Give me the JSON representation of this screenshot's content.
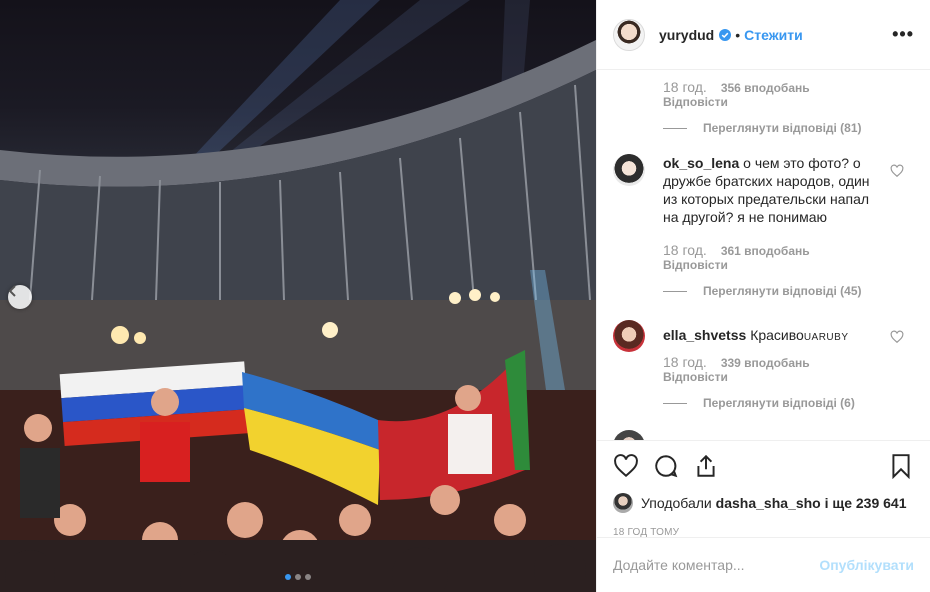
{
  "post": {
    "username": "yurydud",
    "separator": "•",
    "follow_label": "Стежити",
    "more_label": "•••"
  },
  "comments": {
    "partial": {
      "time": "18 год.",
      "likes": "356 вподобань",
      "reply": "Відповісти",
      "view_replies": "Переглянути відповіді (81)"
    },
    "items": [
      {
        "username": "ok_so_lena",
        "text": "о чем это фото? о дружбе братских народов, один из которых предательски напал на другой? я не понимаю",
        "time": "18 год.",
        "likes": "361 вподобань",
        "reply": "Відповісти",
        "view_replies": "Переглянути відповіді (45)"
      },
      {
        "username": "ella_shvetss",
        "text": "Красиво",
        "flags": "UARUBY",
        "time": "18 год.",
        "likes": "339 вподобань",
        "reply": "Відповісти",
        "view_replies": "Переглянути відповіді (6)"
      }
    ]
  },
  "likes_line": {
    "prefix": "Уподобали",
    "user": "dasha_sha_sho",
    "suffix": "і ще 239 641"
  },
  "post_date": "18 ГОД ТОМУ",
  "compose": {
    "placeholder": "Додайте коментар...",
    "publish_label": "Опублікувати"
  },
  "icons": {
    "prev": "chevron-left-icon",
    "like": "heart-icon",
    "comment": "comment-icon",
    "share": "share-icon",
    "save": "bookmark-icon",
    "verified": "verified-badge-icon"
  },
  "colors": {
    "accent": "#3897f0",
    "muted": "#999999",
    "publish_disabled": "#b2dffc"
  },
  "carousel": {
    "slides": 3,
    "active_index": 0
  }
}
